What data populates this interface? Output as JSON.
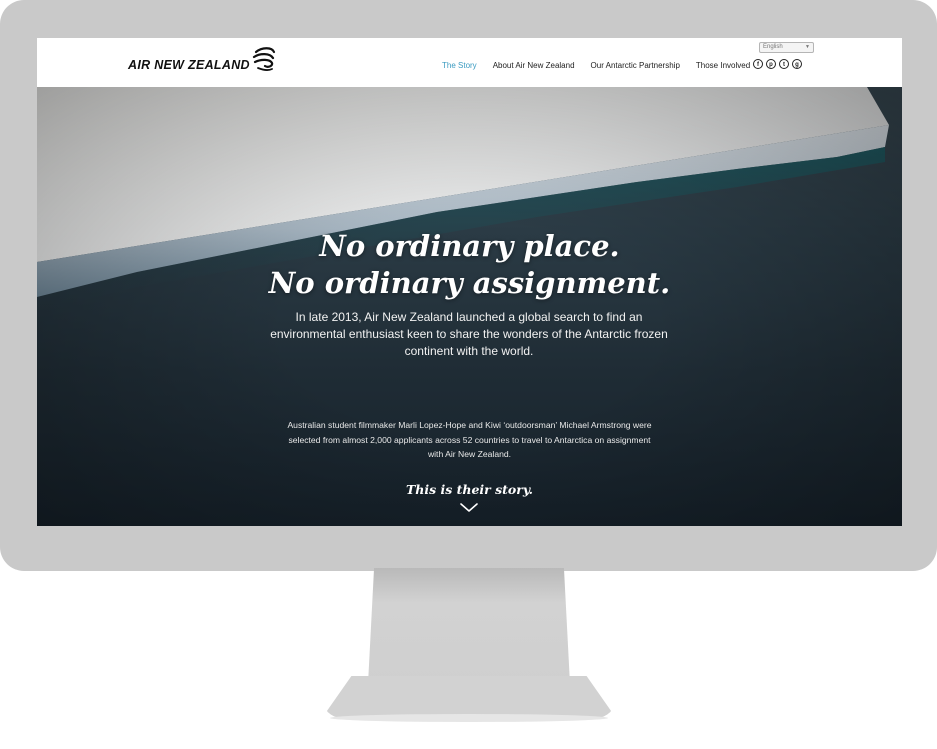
{
  "brand": {
    "name": "AIR NEW ZEALAND"
  },
  "language": {
    "selected": "English"
  },
  "nav": {
    "items": [
      {
        "label": "The Story",
        "active": true
      },
      {
        "label": "About Air New Zealand",
        "active": false
      },
      {
        "label": "Our Antarctic Partnership",
        "active": false
      },
      {
        "label": "Those Involved",
        "active": false
      }
    ]
  },
  "social": [
    {
      "icon": "facebook-icon",
      "glyph": "f"
    },
    {
      "icon": "pinterest-icon",
      "glyph": "p"
    },
    {
      "icon": "twitter-icon",
      "glyph": "t"
    },
    {
      "icon": "google-plus-icon",
      "glyph": "g"
    }
  ],
  "hero": {
    "headline_line1": "No ordinary place.",
    "headline_line2": "No ordinary assignment.",
    "lead": "In late 2013, Air New Zealand launched a global search to find an environmental enthusiast keen to share the wonders of the Antarctic frozen continent with the world.",
    "body": "Australian student filmmaker Marli Lopez-Hope and Kiwi ‘outdoorsman’ Michael Armstrong were selected from almost 2,000 applicants across 52 countries to travel to Antarctica on assignment with Air New Zealand.",
    "story_tagline": "This is their story."
  },
  "colors": {
    "nav_active": "#3b9bc1",
    "bezel": "#c9c9c9"
  }
}
